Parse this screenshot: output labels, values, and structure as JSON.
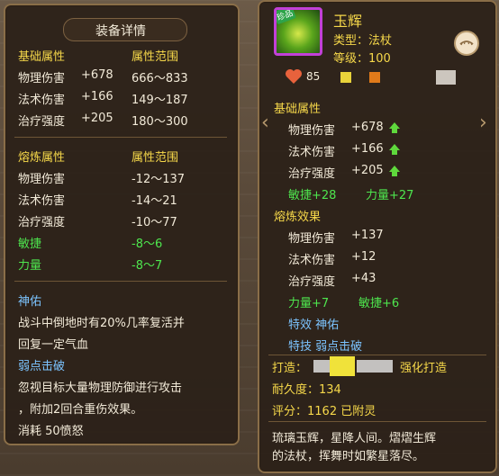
{
  "left": {
    "title": "装备详情",
    "base_header": "基础属性",
    "range_header": "属性范围",
    "base_rows": [
      {
        "name": "物理伤害",
        "value": "+678",
        "range": "666～833"
      },
      {
        "name": "法术伤害",
        "value": "+166",
        "range": "149～187"
      },
      {
        "name": "治疗强度",
        "value": "+205",
        "range": "180～300"
      }
    ],
    "refine_header": "熔炼属性",
    "refine_range_header": "属性范围",
    "refine_rows": [
      {
        "name": "物理伤害",
        "range": "-12～137"
      },
      {
        "name": "法术伤害",
        "range": "-14～21"
      },
      {
        "name": "治疗强度",
        "range": "-10～77"
      },
      {
        "name": "敏捷",
        "range": "-8～6"
      },
      {
        "name": "力量",
        "range": "-8～7"
      }
    ],
    "skill1_title": "神佑",
    "skill1_desc_line1": "战斗中倒地时有20%几率复活并",
    "skill1_desc_line2": "回复一定气血",
    "skill2_title": "弱点击破",
    "skill2_desc_line1": "忽视目标大量物理防御进行攻击",
    "skill2_desc_line2": "，附加2回合重伤效果。",
    "skill2_cost": "消耗  50愤怒"
  },
  "right": {
    "item_name": "玉辉",
    "badge": "珍品",
    "type_label": "类型：法杖",
    "level_label": "等级：100",
    "hp_value": "85",
    "base_header": "基础属性",
    "base_rows": [
      {
        "name": "物理伤害",
        "value": "+678"
      },
      {
        "name": "法术伤害",
        "value": "+166"
      },
      {
        "name": "治疗强度",
        "value": "+205"
      }
    ],
    "bonus1": "敏捷+28",
    "bonus2": "力量+27",
    "refine_header": "熔炼效果",
    "refine_rows": [
      {
        "name": "物理伤害",
        "value": "+137"
      },
      {
        "name": "法术伤害",
        "value": "+12"
      },
      {
        "name": "治疗强度",
        "value": "+43"
      }
    ],
    "refine_bonus1": "力量+7",
    "refine_bonus2": "敏捷+6",
    "effect_label": "特效  神佑",
    "skill_label": "特技  弱点击破",
    "forge_label": "打造：",
    "forge_suffix": "强化打造",
    "durability": "耐久度：134",
    "score": "评分：1162   已附灵",
    "flavor_line1": "琉璃玉辉，星降人间。熠熠生辉",
    "flavor_line2": "的法杖，挥舞时如繁星落尽。"
  },
  "colors": {
    "stat_white": "#f2ead8",
    "header_yellow": "#f6d84a",
    "attr_green": "#4ee64e",
    "skill_blue": "#7cc4ff",
    "frame_gold": "#8a6e48"
  }
}
